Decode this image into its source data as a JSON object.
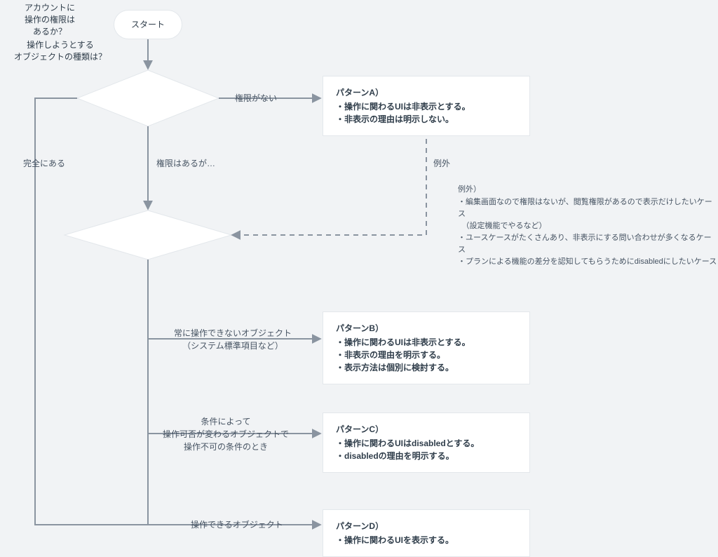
{
  "start": {
    "label": "スタート"
  },
  "decision1": {
    "line1": "アカウントに",
    "line2": "操作の権限は",
    "line3": "あるか？"
  },
  "decision2": {
    "line1": "操作しようとする",
    "line2": "オブジェクトの種類は？"
  },
  "edges": {
    "no_permission": "権限がない",
    "has_permission_but": "権限はあるが…",
    "fully_has": "完全にある",
    "exception": "例外",
    "always_unop_l1": "常に操作できないオブジェクト",
    "always_unop_l2": "（システム標準項目など）",
    "conditional_l1": "条件によって",
    "conditional_l2": "操作可否が変わるオブジェクトで",
    "conditional_l3": "操作不可の条件のとき",
    "operable": "操作できるオブジェクト"
  },
  "patternA": {
    "title": "パターンA）",
    "b1": "・操作に関わるUIは非表示とする。",
    "b2": "・非表示の理由は明示しない。"
  },
  "patternB": {
    "title": "パターンB）",
    "b1": "・操作に関わるUIは非表示とする。",
    "b2": "・非表示の理由を明示する。",
    "b3": "・表示方法は個別に検討する。"
  },
  "patternC": {
    "title": "パターンC）",
    "b1": "・操作に関わるUIはdisabledとする。",
    "b2": "・disabledの理由を明示する。"
  },
  "patternD": {
    "title": "パターンD）",
    "b1": "・操作に関わるUIを表示する。"
  },
  "exception_note": {
    "title": "例外）",
    "l1": "・編集画面なので権限はないが、閲覧権限があるので表示だけしたいケース",
    "l2": "　（設定機能でやるなど）",
    "l3": "・ユースケースがたくさんあり、非表示にする問い合わせが多くなるケース",
    "l4": "・プランによる機能の差分を認知してもらうためにdisabledにしたいケース"
  },
  "chart_data": {
    "type": "flowchart",
    "nodes": [
      {
        "id": "start",
        "kind": "terminator",
        "label": "スタート"
      },
      {
        "id": "d1",
        "kind": "decision",
        "label": "アカウントに操作の権限はあるか？"
      },
      {
        "id": "pA",
        "kind": "process",
        "label": "パターンA）操作に関わるUIは非表示とする。非表示の理由は明示しない。"
      },
      {
        "id": "d2",
        "kind": "decision",
        "label": "操作しようとするオブジェクトの種類は？"
      },
      {
        "id": "pB",
        "kind": "process",
        "label": "パターンB）操作に関わるUIは非表示とする。非表示の理由を明示する。表示方法は個別に検討する。"
      },
      {
        "id": "pC",
        "kind": "process",
        "label": "パターンC）操作に関わるUIはdisabledとする。disabledの理由を明示する。"
      },
      {
        "id": "pD",
        "kind": "process",
        "label": "パターンD）操作に関わるUIを表示する。"
      },
      {
        "id": "note",
        "kind": "annotation",
        "label": "例外）編集画面なので権限はないが閲覧権限があるので表示だけしたいケース（設定機能でやるなど）／ユースケースがたくさんあり非表示にする問い合わせが多くなるケース／プランによる機能の差分を認知してもらうためにdisabledにしたいケース"
      }
    ],
    "edges": [
      {
        "from": "start",
        "to": "d1",
        "label": ""
      },
      {
        "from": "d1",
        "to": "pA",
        "label": "権限がない"
      },
      {
        "from": "d1",
        "to": "d2",
        "label": "権限はあるが…"
      },
      {
        "from": "pA",
        "to": "d2",
        "label": "例外",
        "style": "dashed"
      },
      {
        "from": "d2",
        "to": "pB",
        "label": "常に操作できないオブジェクト（システム標準項目など）"
      },
      {
        "from": "d2",
        "to": "pC",
        "label": "条件によって操作可否が変わるオブジェクトで操作不可の条件のとき"
      },
      {
        "from": "d2",
        "to": "pD",
        "label": "操作できるオブジェクト"
      },
      {
        "from": "d1",
        "to": "start",
        "label": "完全にある",
        "path": "back-loop"
      }
    ]
  }
}
